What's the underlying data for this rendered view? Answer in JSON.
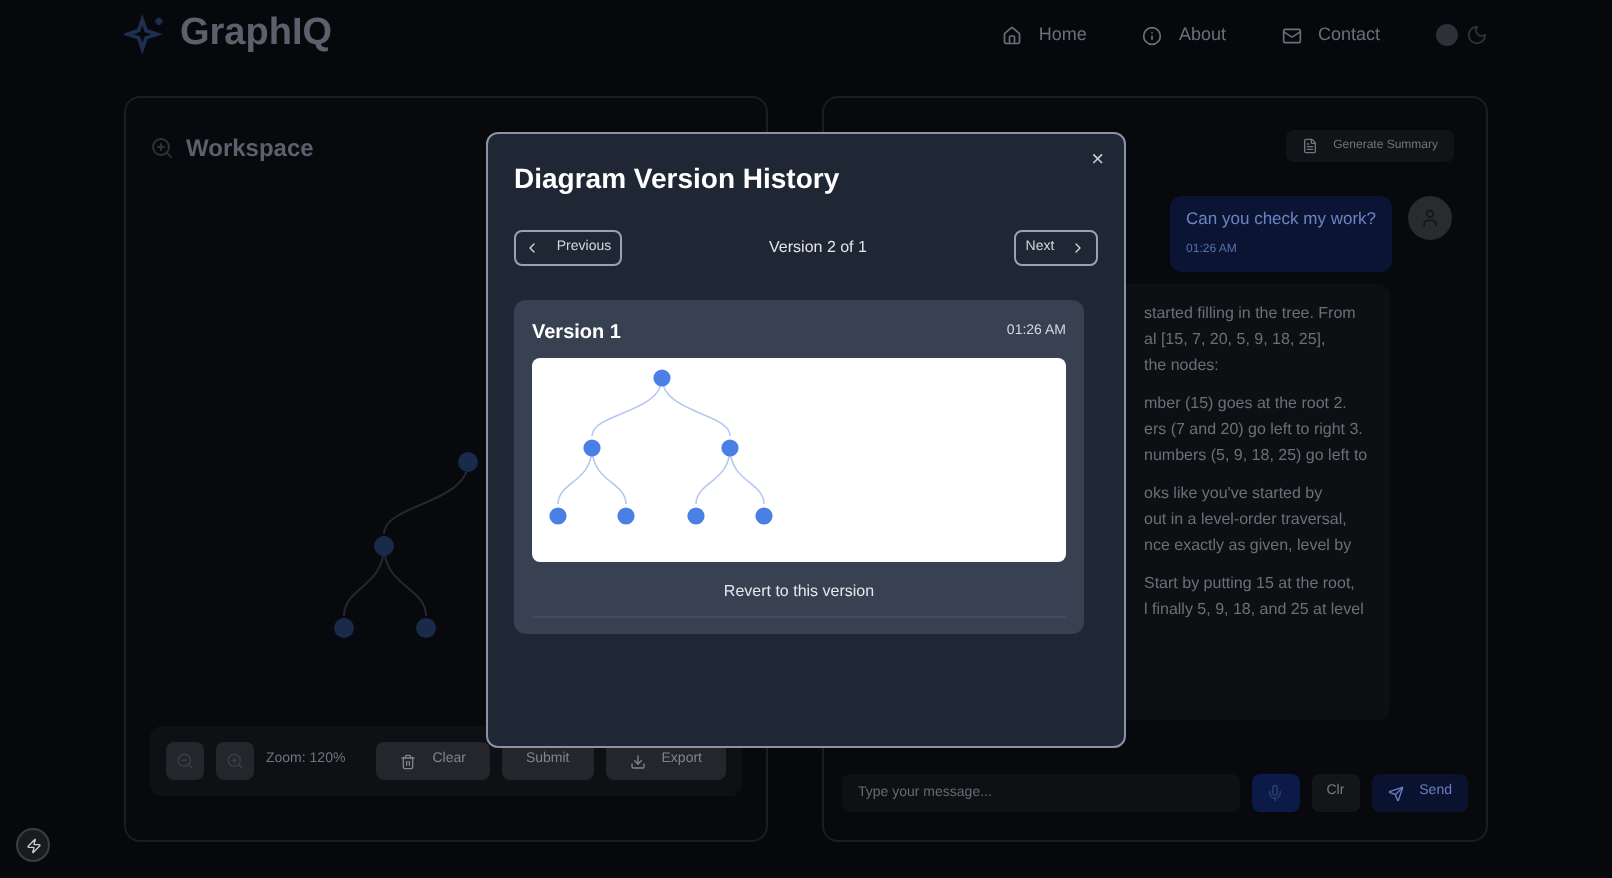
{
  "header": {
    "logo": "GraphIQ",
    "nav": [
      {
        "label": "Home",
        "kind": "home"
      },
      {
        "label": "About",
        "kind": "about"
      },
      {
        "label": "Contact",
        "kind": "contact"
      }
    ]
  },
  "workspace": {
    "title": "Workspace",
    "zoom": "Zoom: 120%",
    "actions": [
      {
        "label": "Clear",
        "kind": "clear"
      },
      {
        "label": "Submit",
        "kind": "submit"
      },
      {
        "label": "Export",
        "kind": "export"
      }
    ]
  },
  "chat": {
    "summary_button": "Generate Summary",
    "user_message": {
      "text": "Can you check my work?",
      "time": "01:26 AM"
    },
    "bot_paragraphs": [
      [
        "started filling in the tree. From",
        "al [15, 7, 20, 5, 9, 18, 25],",
        "the nodes:"
      ],
      [
        "mber (15) goes at the root 2.",
        "ers (7 and 20) go left to right 3.",
        "numbers (5, 9, 18, 25) go left to"
      ],
      [
        "oks like you've started by",
        "out in a level-order traversal,",
        "nce exactly as given, level by"
      ],
      [
        "Start by putting 15 at the root,",
        "l finally 5, 9, 18, and 25 at level"
      ]
    ],
    "input": {
      "placeholder": "Type your message..."
    },
    "clear_button": "Clr",
    "send_button": "Send"
  },
  "modal": {
    "title": "Diagram Version History",
    "close": "×",
    "previous": "Previous",
    "position": "Version 2 of 1",
    "next": "Next",
    "version": {
      "title": "Version 1",
      "time": "01:26 AM"
    },
    "revert": "Revert to this version"
  }
}
